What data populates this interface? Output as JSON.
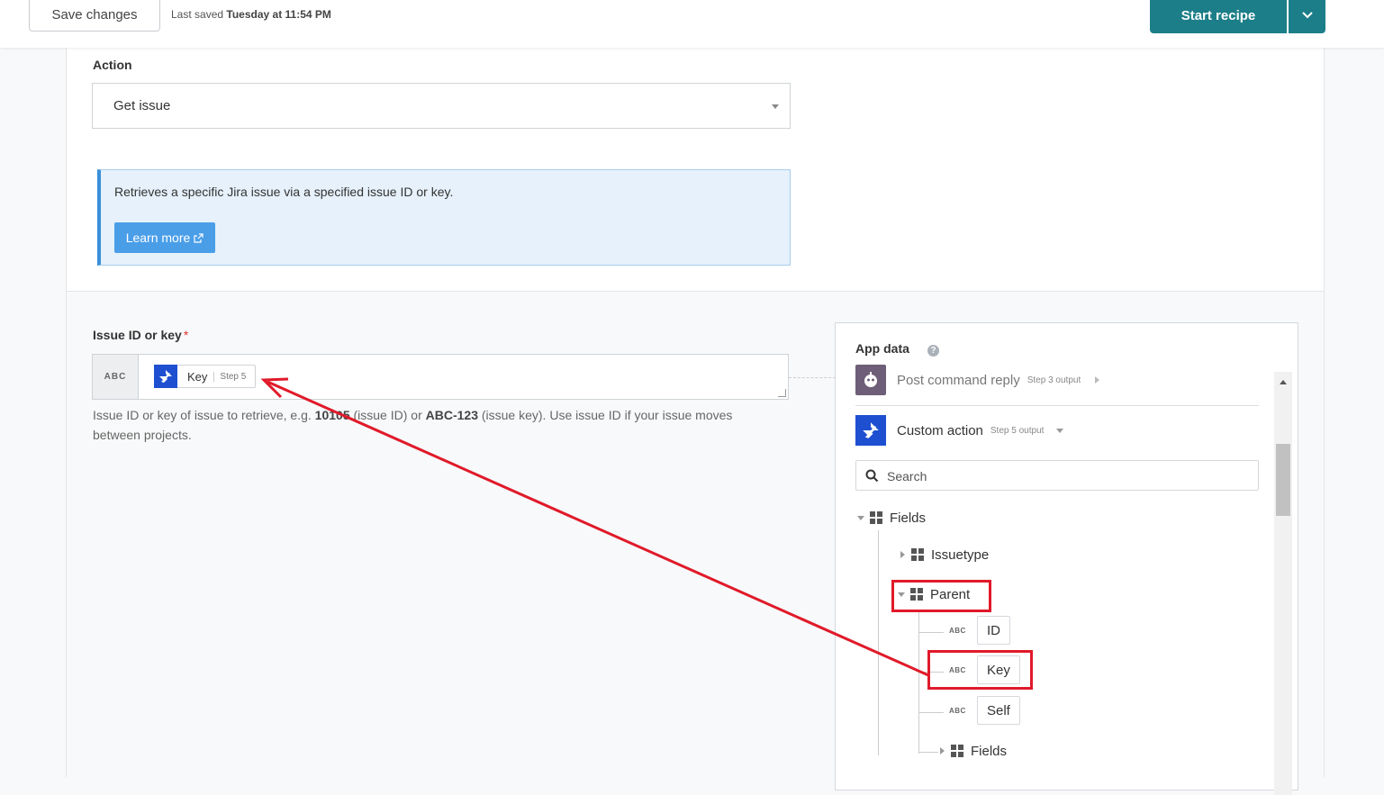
{
  "toolbar": {
    "save_label": "Save changes",
    "last_saved_prefix": "Last saved",
    "last_saved_time": "Tuesday at 11:54 PM",
    "start_label": "Start recipe"
  },
  "action": {
    "label": "Action",
    "value": "Get issue",
    "info_text": "Retrieves a specific Jira issue via a specified issue ID or key.",
    "learn_more": "Learn more"
  },
  "issue_field": {
    "label": "Issue ID or key",
    "required_marker": "*",
    "type_badge": "ABC",
    "pill_label": "Key",
    "pill_step": "Step 5",
    "help_1": "Issue ID or key of issue to retrieve, e.g. ",
    "help_example_id": "10105",
    "help_2": " (issue ID) or ",
    "help_example_key": "ABC-123",
    "help_3": " (issue key). Use issue ID if your issue moves between projects."
  },
  "app_data": {
    "title": "App data",
    "help_glyph": "?",
    "steps": [
      {
        "name": "Post command reply",
        "sub": "Step 3 output"
      },
      {
        "name": "Custom action",
        "sub": "Step 5 output"
      }
    ],
    "search_placeholder": "Search",
    "tree": {
      "fields": "Fields",
      "issuetype": "Issuetype",
      "parent": "Parent",
      "leaf_badge": "ABC",
      "leaves": [
        "ID",
        "Key",
        "Self"
      ],
      "sub_fields": "Fields"
    }
  },
  "colors": {
    "brand_teal": "#1c7e88",
    "jira_blue": "#1f4fd1",
    "annotation_red": "#e01a2a",
    "info_blue": "#4a9ee8"
  }
}
